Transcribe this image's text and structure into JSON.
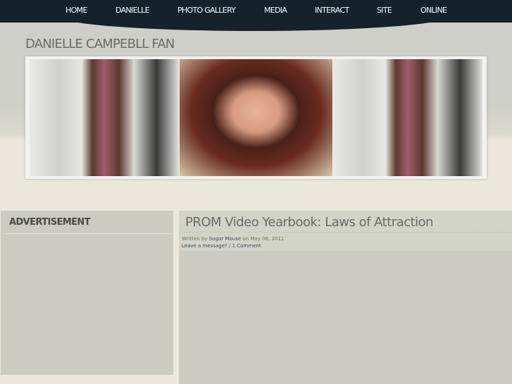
{
  "nav": {
    "items": [
      "HOME",
      "DANIELLE",
      "PHOTO GALLERY",
      "MEDIA",
      "INTERACT",
      "SITE",
      "ONLINE"
    ]
  },
  "site_title": "DANIELLE CAMPEBLL FAN",
  "sidebar": {
    "heading": "ADVERTISEMENT"
  },
  "post": {
    "title": "PROM Video Yearbook: Laws of Attraction",
    "written_by": "Written by",
    "author": "Sugar Mouse",
    "on": "on",
    "date": "May 06, 2011",
    "leave_message": "Leave a message?",
    "sep": "/",
    "comments": "1 Comment"
  }
}
